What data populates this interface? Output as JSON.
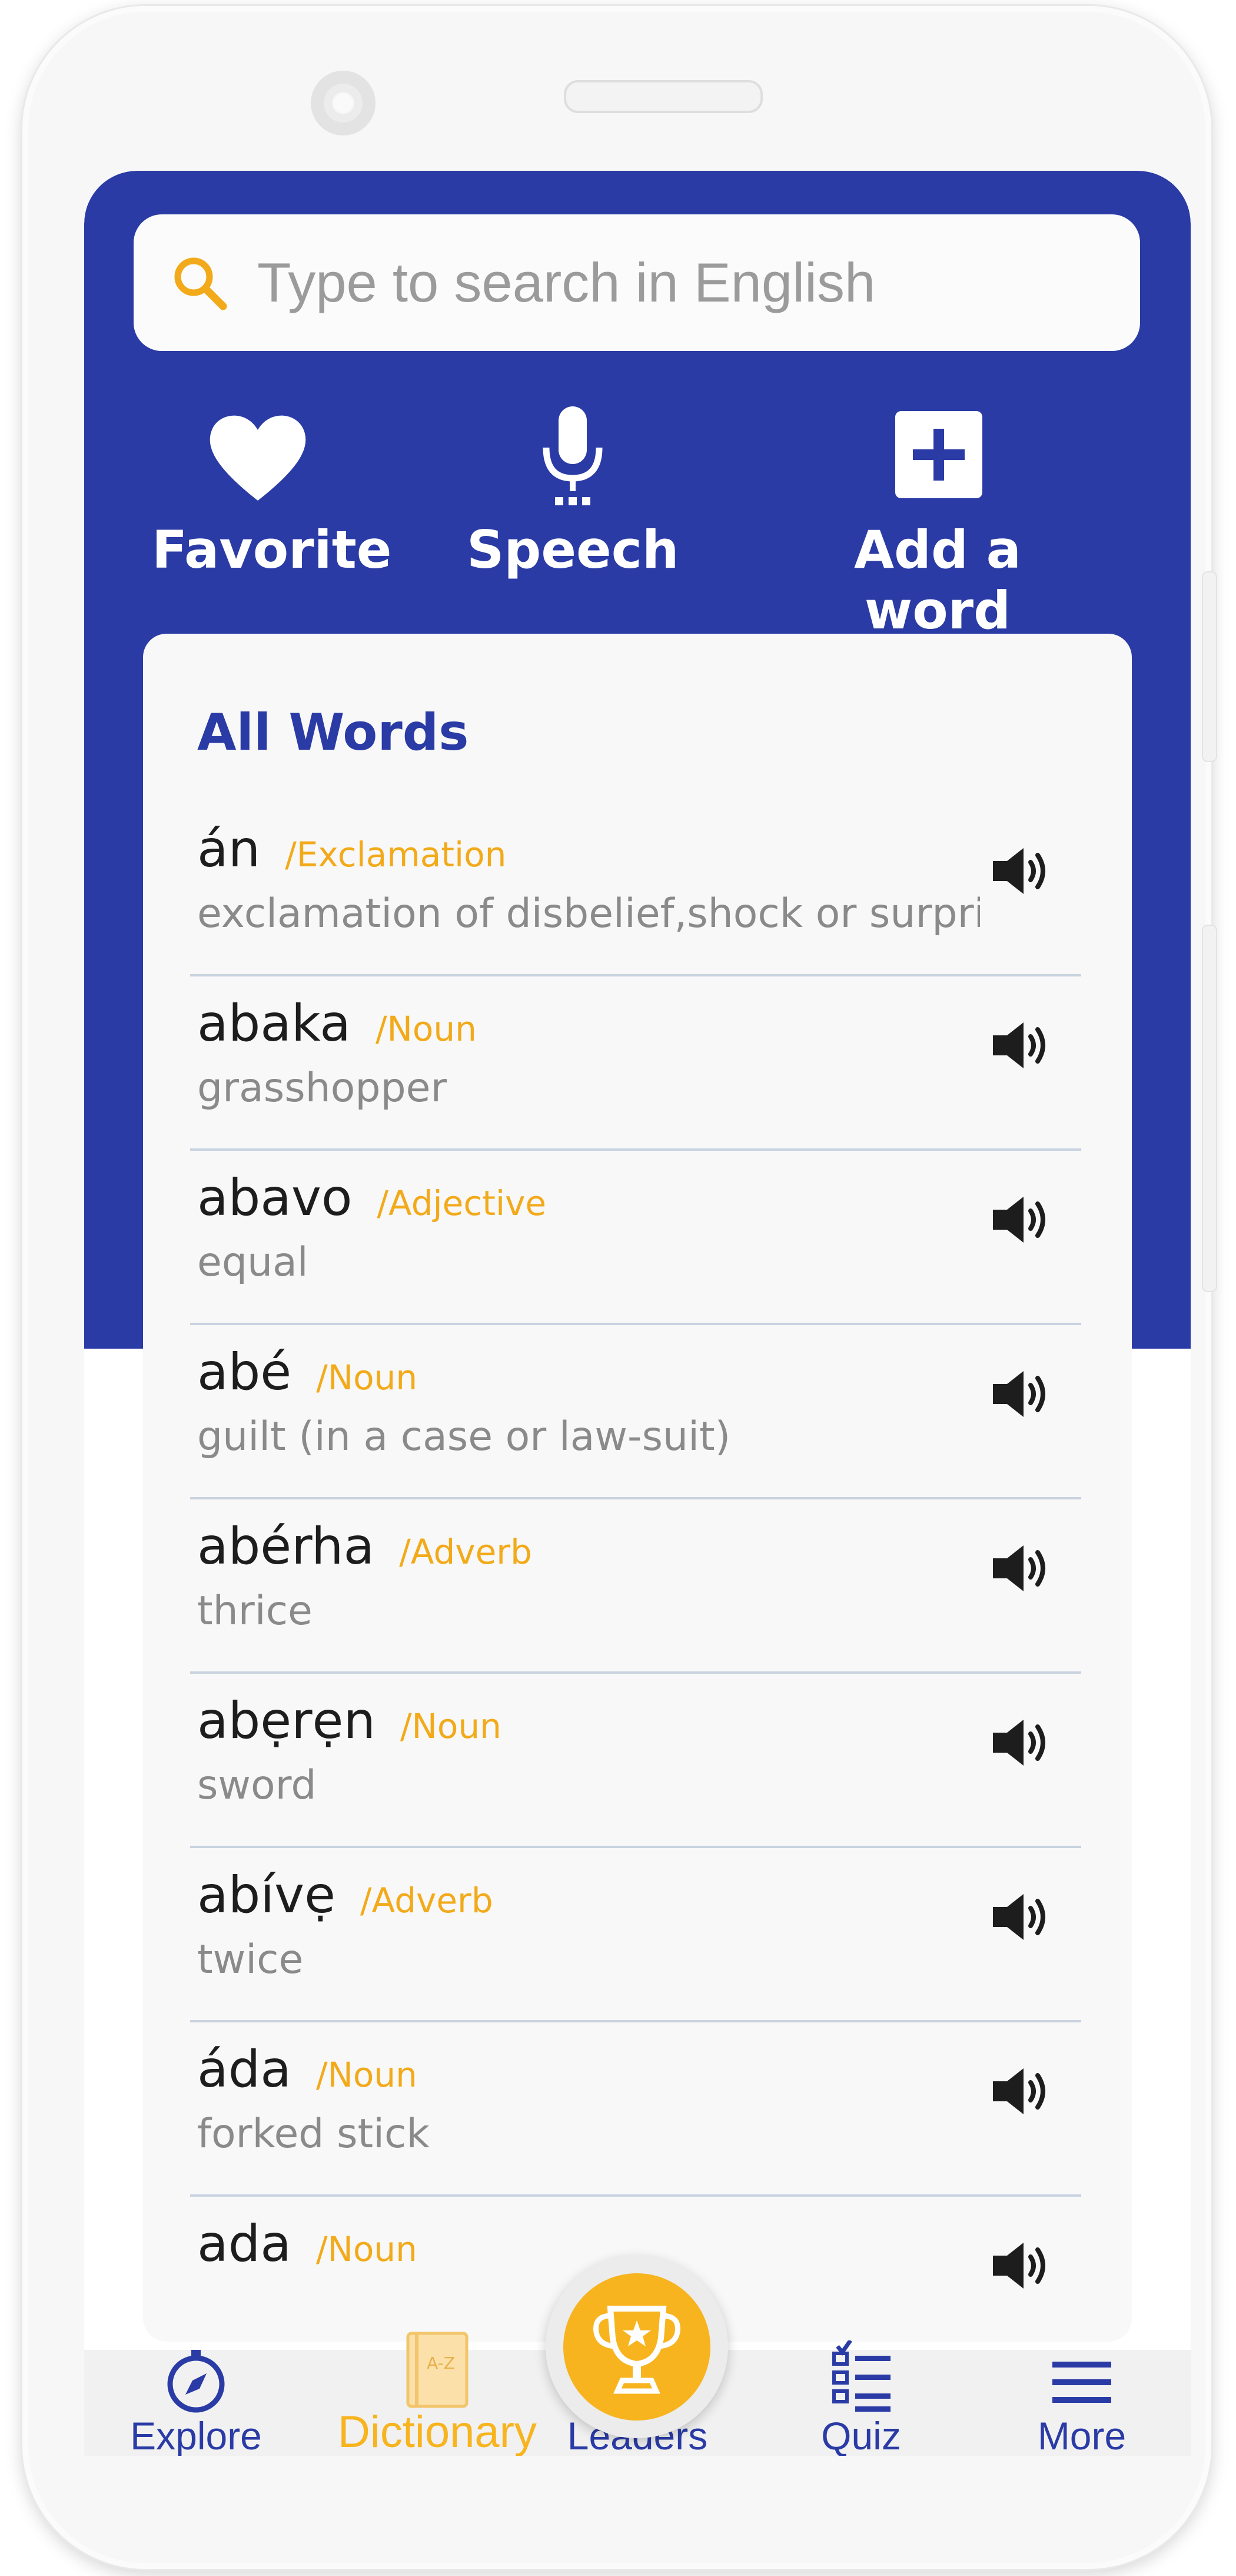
{
  "search": {
    "placeholder": "Type to search in English"
  },
  "actions": {
    "favorite": "Favorite",
    "speech": "Speech",
    "add_word": "Add a word"
  },
  "list_title": "All Words",
  "words": [
    {
      "word": "án",
      "pos": "/Exclamation",
      "definition": "exclamation of disbelief,shock or surpri....."
    },
    {
      "word": "abaka",
      "pos": "/Noun",
      "definition": "grasshopper"
    },
    {
      "word": "abavo",
      "pos": "/Adjective",
      "definition": "equal"
    },
    {
      "word": "abé",
      "pos": "/Noun",
      "definition": "guilt (in a case or law-suit)"
    },
    {
      "word": "abérha",
      "pos": "/Adverb",
      "definition": "thrice"
    },
    {
      "word": "abẹrẹn",
      "pos": "/Noun",
      "definition": "sword"
    },
    {
      "word": "abívẹ",
      "pos": "/Adverb",
      "definition": "twice"
    },
    {
      "word": "áda",
      "pos": "/Noun",
      "definition": "forked stick"
    },
    {
      "word": "ada",
      "pos": "/Noun",
      "definition": ""
    }
  ],
  "nav": {
    "explore": "Explore",
    "dictionary": "Dictionary",
    "leaders": "Leaders",
    "quiz": "Quiz",
    "more": "More"
  },
  "colors": {
    "primary": "#2a3ba6",
    "accent": "#f7b41f",
    "part_of_speech": "#f2aa1a"
  }
}
